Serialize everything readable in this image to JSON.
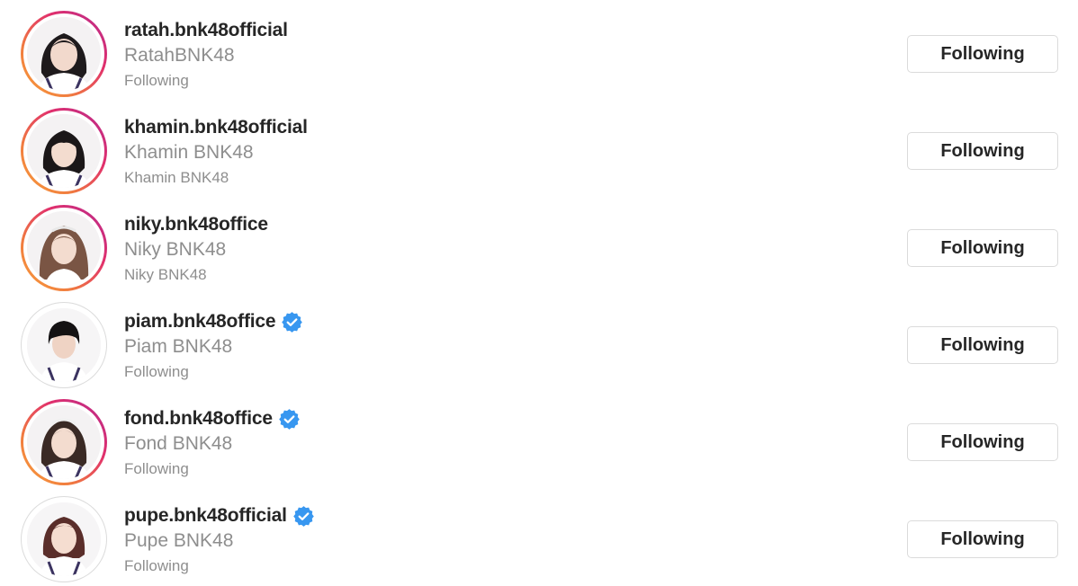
{
  "colors": {
    "username": "#262626",
    "secondary_text": "#8e8e8e",
    "button_border": "#dbdbdb",
    "verified_blue": "#3897f0",
    "story_ring_start": "#f9a03a",
    "story_ring_end": "#b52a8f"
  },
  "accounts": [
    {
      "username": "ratah.bnk48official",
      "full_name": "RatahBNK48",
      "subtext": "Following",
      "verified": false,
      "story_ring": true,
      "button_label": "Following",
      "avatar_icon": "profile-photo"
    },
    {
      "username": "khamin.bnk48official",
      "full_name": "Khamin BNK48",
      "subtext": "Khamin BNK48",
      "verified": false,
      "story_ring": true,
      "button_label": "Following",
      "avatar_icon": "profile-photo"
    },
    {
      "username": "niky.bnk48office",
      "full_name": "Niky BNK48",
      "subtext": "Niky BNK48",
      "verified": false,
      "story_ring": true,
      "button_label": "Following",
      "avatar_icon": "profile-photo"
    },
    {
      "username": "piam.bnk48office",
      "full_name": "Piam BNK48",
      "subtext": "Following",
      "verified": true,
      "story_ring": false,
      "button_label": "Following",
      "avatar_icon": "profile-photo"
    },
    {
      "username": "fond.bnk48office",
      "full_name": "Fond BNK48",
      "subtext": "Following",
      "verified": true,
      "story_ring": true,
      "button_label": "Following",
      "avatar_icon": "profile-photo"
    },
    {
      "username": "pupe.bnk48official",
      "full_name": "Pupe BNK48",
      "subtext": "Following",
      "verified": true,
      "story_ring": false,
      "button_label": "Following",
      "avatar_icon": "profile-photo"
    }
  ]
}
